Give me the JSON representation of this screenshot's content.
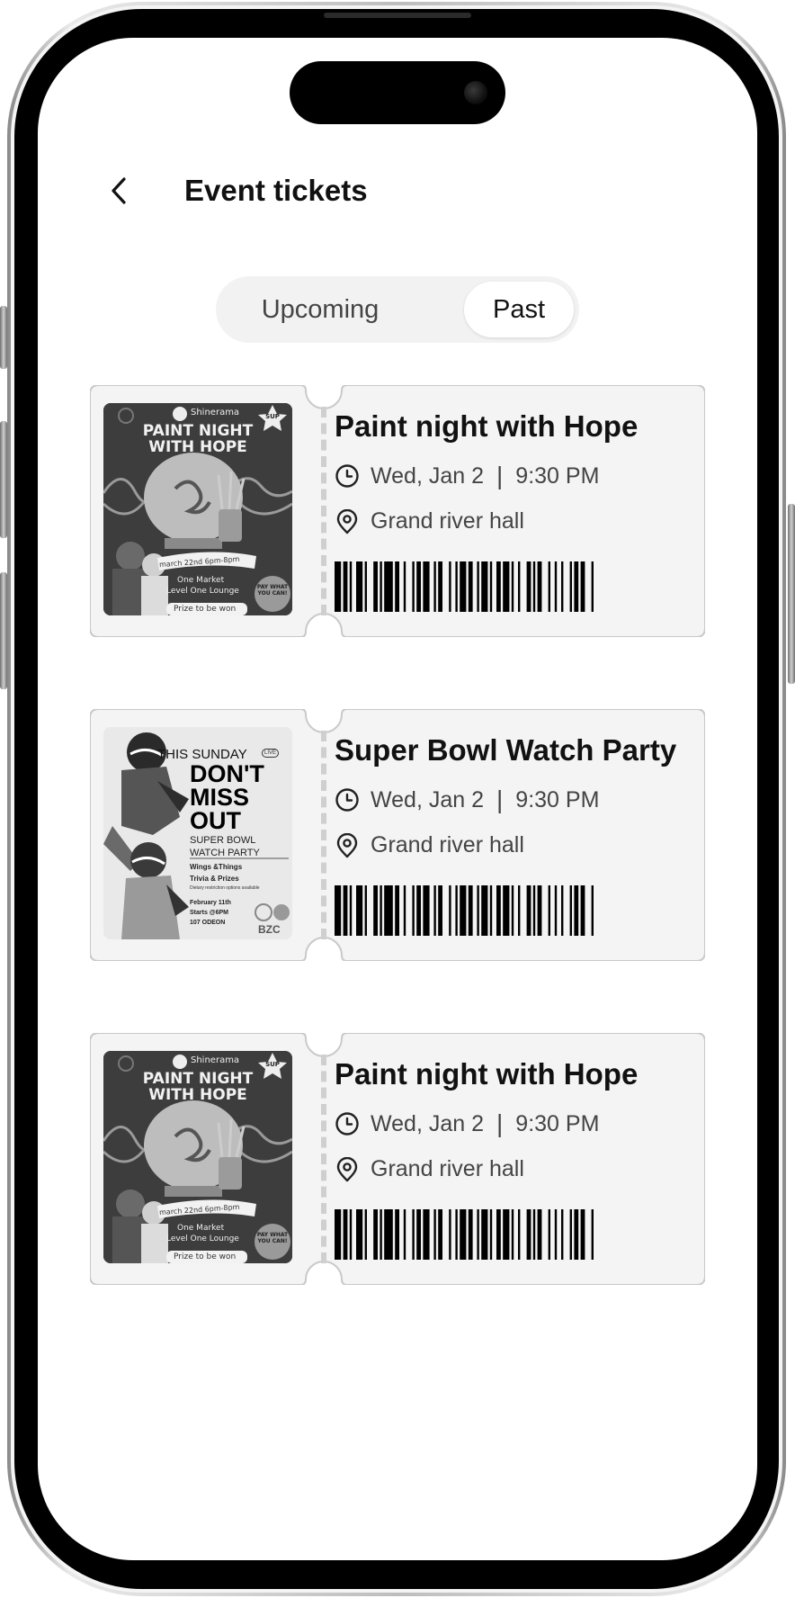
{
  "header": {
    "title": "Event tickets"
  },
  "tabs": [
    {
      "label": "Upcoming",
      "selected": false
    },
    {
      "label": "Past",
      "selected": true
    }
  ],
  "tickets": [
    {
      "title": "Paint night with Hope",
      "date": "Wed, Jan 2",
      "time": "9:30 PM",
      "location": "Grand river hall",
      "poster": {
        "brand": "Shinerama",
        "headline": "PAINT NIGHT WITH HOPE",
        "date_line": "march 22nd 6pm-8pm",
        "venue_line1": "One Market",
        "venue_line2": "Level One Lounge",
        "prize": "Prize to be won",
        "badge": "PAY WHAT YOU CAN!",
        "corner": "SUP"
      }
    },
    {
      "title": "Super Bowl Watch Party",
      "date": "Wed, Jan 2",
      "time": "9:30 PM",
      "location": "Grand river hall",
      "poster": {
        "kicker": "THIS SUNDAY",
        "live": "LIVE",
        "headline1": "DON'T",
        "headline2": "MISS",
        "headline3": "OUT",
        "sub1": "SUPER BOWL",
        "sub2": "WATCH PARTY",
        "item1": "Wings &Things",
        "item2": "Trivia & Prizes",
        "note": "Dietary restriction options available",
        "date_line": "February 11th",
        "time_line": "Starts @6PM",
        "venue_line": "107 ODEON",
        "brand": "BZC"
      }
    },
    {
      "title": "Paint night with Hope",
      "date": "Wed, Jan 2",
      "time": "9:30 PM",
      "location": "Grand river hall",
      "poster": {
        "brand": "Shinerama",
        "headline": "PAINT NIGHT WITH HOPE",
        "date_line": "march 22nd 6pm-8pm",
        "venue_line1": "One Market",
        "venue_line2": "Level One Lounge",
        "prize": "Prize to be won",
        "badge": "PAY WHAT YOU CAN!",
        "corner": "SUP"
      }
    }
  ]
}
